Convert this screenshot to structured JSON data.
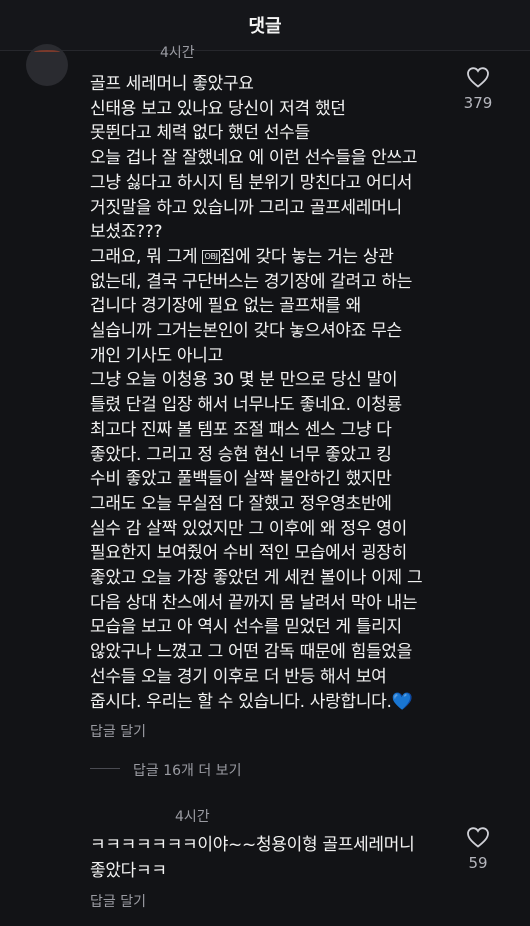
{
  "header": {
    "title": "댓글"
  },
  "comment1": {
    "time": "4시간",
    "text": "골프 세레머니 좋았구요\n신태용 보고 있나요 당신이 저격 했던\n못뛴다고 체력 없다 했던 선수들\n오늘 겁나 잘 잘했네요 에 이런 선수들을 안쓰고\n그냥 싫다고 하시지 팀 분위기 망친다고 어디서\n거짓말을 하고 있습니까 그리고 골프세레머니\n보셨죠???\n그래요, 뭐 그게 ",
    "obj": "OBJ",
    "text_after": "집에 갖다 놓는 거는 상관\n없는데, 결국 구단버스는 경기장에 갈려고 하는\n겁니다 경기장에 필요 없는 골프채를 왜\n실습니까 그거는본인이 갖다 놓으셔야죠 무슨\n개인 기사도 아니고\n그냥 오늘 이청용 30 몇 분 만으로 당신 말이\n틀렸 단걸 입장 해서 너무나도 좋네요. 이청룡\n최고다 진짜 볼 템포 조절 패스 센스 그냥 다\n좋았다. 그리고 정 승현 현신 너무 좋았고 킹\n수비 좋았고 풀백들이 살짝 불안하긴 했지만\n그래도 오늘 무실점 다 잘했고 정우영초반에\n실수 감 살짝 있었지만 그 이후에 왜 정우 영이\n필요한지 보여줬어 수비 적인 모습에서 굉장히\n좋았고 오늘 가장 좋았던 게 세컨 볼이나 이제 그\n다음 상대 찬스에서 끝까지 몸 날려서 막아 내는\n모습을 보고 아 역시 선수를 믿었던 게 틀리지\n않았구나 느꼈고 그 어떤 감독 때문에 힘들었을\n선수들 오늘 경기 이후로 더 반등 해서 보여\n줍시다. 우리는 할 수 있습니다. 사랑합니다.💙",
    "likes": "379",
    "reply_label": "답글 달기"
  },
  "more_replies": "답글 16개 더 보기",
  "comment2": {
    "time": "4시간",
    "text": "ㅋㅋㅋㅋㅋㅋㅋ이야~~청용이형 골프세레머니\n좋았다ㅋㅋ",
    "likes": "59",
    "reply_label": "답글 달기"
  }
}
